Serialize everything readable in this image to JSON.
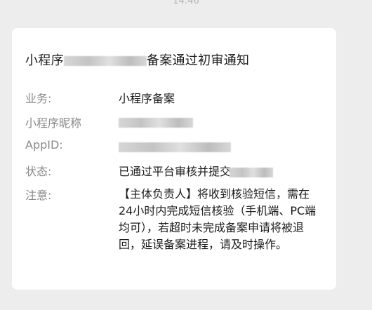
{
  "time": "14:46",
  "card": {
    "title_prefix": "小程序",
    "title_suffix": "备案通过初审通知",
    "rows": [
      {
        "label": "业务:",
        "value": "小程序备案"
      },
      {
        "label": "小程序昵称",
        "value": ""
      },
      {
        "label": "AppID:",
        "value": ""
      },
      {
        "label": "状态:",
        "value": "已通过平台审核并提交"
      },
      {
        "label": "注意:",
        "value": "【主体负责人】将收到核验短信，需在24小时内完成短信核验（手机端、PC端均可），若超时未完成备案申请将被退回，延误备案进程，请及时操作。"
      }
    ]
  }
}
